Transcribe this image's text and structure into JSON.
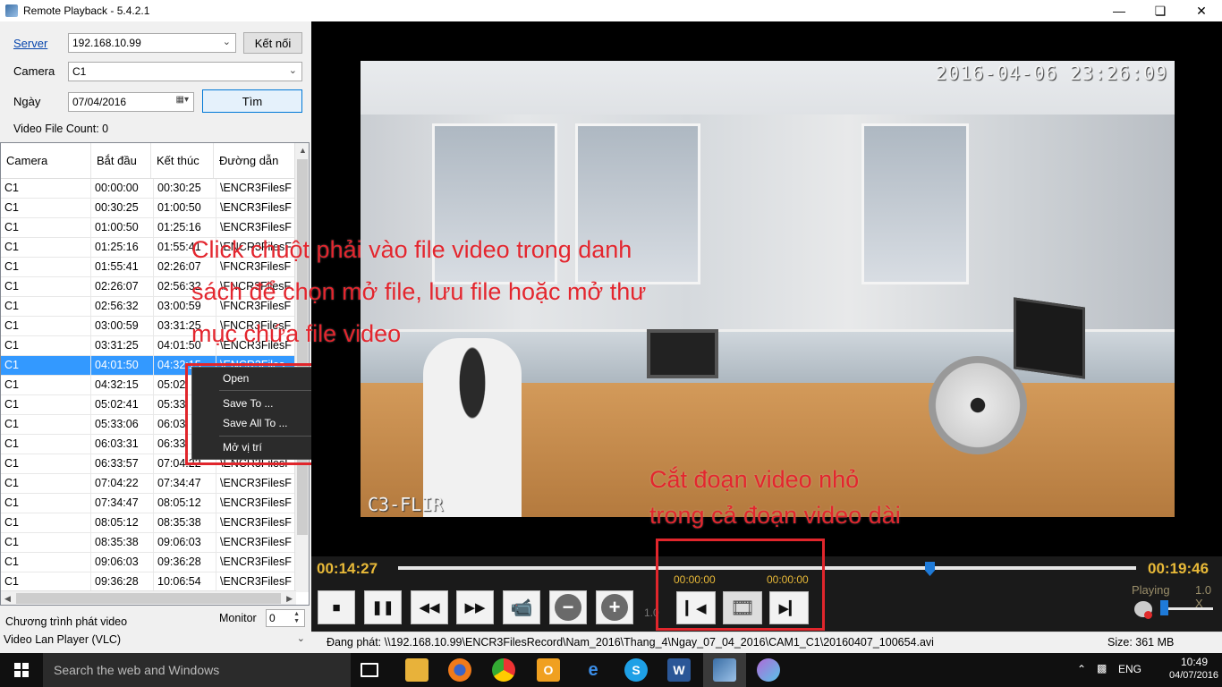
{
  "window": {
    "title": "Remote Playback - 5.4.2.1"
  },
  "form": {
    "server_label": "Server",
    "server_value": "192.168.10.99",
    "connect_button": "Kết nối",
    "camera_label": "Camera",
    "camera_value": "C1",
    "date_label": "Ngày",
    "date_value": "07/04/2016",
    "search_button": "Tìm",
    "file_count": "Video File Count: 0"
  },
  "table": {
    "headers": [
      "Camera",
      "Bắt đầu",
      "Kết thúc",
      "Đường dẫn"
    ],
    "rows": [
      [
        "C1",
        "00:00:00",
        "00:30:25",
        "\\ENCR3FilesF"
      ],
      [
        "C1",
        "00:30:25",
        "01:00:50",
        "\\ENCR3FilesF"
      ],
      [
        "C1",
        "01:00:50",
        "01:25:16",
        "\\ENCR3FilesF"
      ],
      [
        "C1",
        "01:25:16",
        "01:55:41",
        "\\ENCR3FilesF"
      ],
      [
        "C1",
        "01:55:41",
        "02:26:07",
        "\\FNCR3FilesF"
      ],
      [
        "C1",
        "02:26:07",
        "02:56:32",
        "\\FNCR3FilesF"
      ],
      [
        "C1",
        "02:56:32",
        "03:00:59",
        "\\FNCR3FilesF"
      ],
      [
        "C1",
        "03:00:59",
        "03:31:25",
        "\\FNCR3FilesF"
      ],
      [
        "C1",
        "03:31:25",
        "04:01:50",
        "\\ENCR3FilesF"
      ],
      [
        "C1",
        "04:01:50",
        "04:32:15",
        "\\ENCR3Files"
      ],
      [
        "C1",
        "04:32:15",
        "05:02",
        ""
      ],
      [
        "C1",
        "05:02:41",
        "05:33",
        ""
      ],
      [
        "C1",
        "05:33:06",
        "06:03",
        ""
      ],
      [
        "C1",
        "06:03:31",
        "06:33",
        ""
      ],
      [
        "C1",
        "06:33:57",
        "07:04:22",
        "\\ENCR3FilesF"
      ],
      [
        "C1",
        "07:04:22",
        "07:34:47",
        "\\ENCR3FilesF"
      ],
      [
        "C1",
        "07:34:47",
        "08:05:12",
        "\\ENCR3FilesF"
      ],
      [
        "C1",
        "08:05:12",
        "08:35:38",
        "\\ENCR3FilesF"
      ],
      [
        "C1",
        "08:35:38",
        "09:06:03",
        "\\ENCR3FilesF"
      ],
      [
        "C1",
        "09:06:03",
        "09:36:28",
        "\\ENCR3FilesF"
      ],
      [
        "C1",
        "09:36:28",
        "10:06:54",
        "\\ENCR3FilesF"
      ]
    ]
  },
  "context_menu": {
    "open": "Open",
    "save_to": "Save To ...",
    "save_all_to": "Save All To ...",
    "open_location": "Mở vị trí"
  },
  "bottom_left": {
    "player_label": "Chương trình phát video",
    "monitor_label": "Monitor",
    "monitor_value": "0",
    "player_value": "Video Lan Player (VLC)"
  },
  "video": {
    "timestamp": "2016-04-06 23:26:09",
    "camera_label": "C3-FLIR"
  },
  "annotations": {
    "right_click_line1": "Click chuột phải vào file video trong danh",
    "right_click_line2": "sách để chọn mở file, lưu file hoặc mở thư",
    "right_click_line3": "mục chứa file video",
    "cut_line1": "Cắt đoạn video nhỏ",
    "cut_line2": "trong cả đoạn video dài"
  },
  "controls": {
    "current_time": "00:14:27",
    "total_time": "00:19:46",
    "cut_start": "00:00:00",
    "cut_end": "00:00:00",
    "speed_hidden": "1.0",
    "status": "Playing",
    "speed": "1.0 X",
    "progress_fraction": 0.72,
    "volume_fraction": 0.0
  },
  "statusbar": {
    "playing_path": "Đang phát: \\\\192.168.10.99\\ENCR3FilesRecord\\Nam_2016\\Thang_4\\Ngay_07_04_2016\\CAM1_C1\\20160407_100654.avi",
    "size": "Size: 361 MB"
  },
  "taskbar": {
    "search_placeholder": "Search the web and Windows",
    "language": "ENG",
    "time": "10:49",
    "date": "04/07/2016"
  }
}
